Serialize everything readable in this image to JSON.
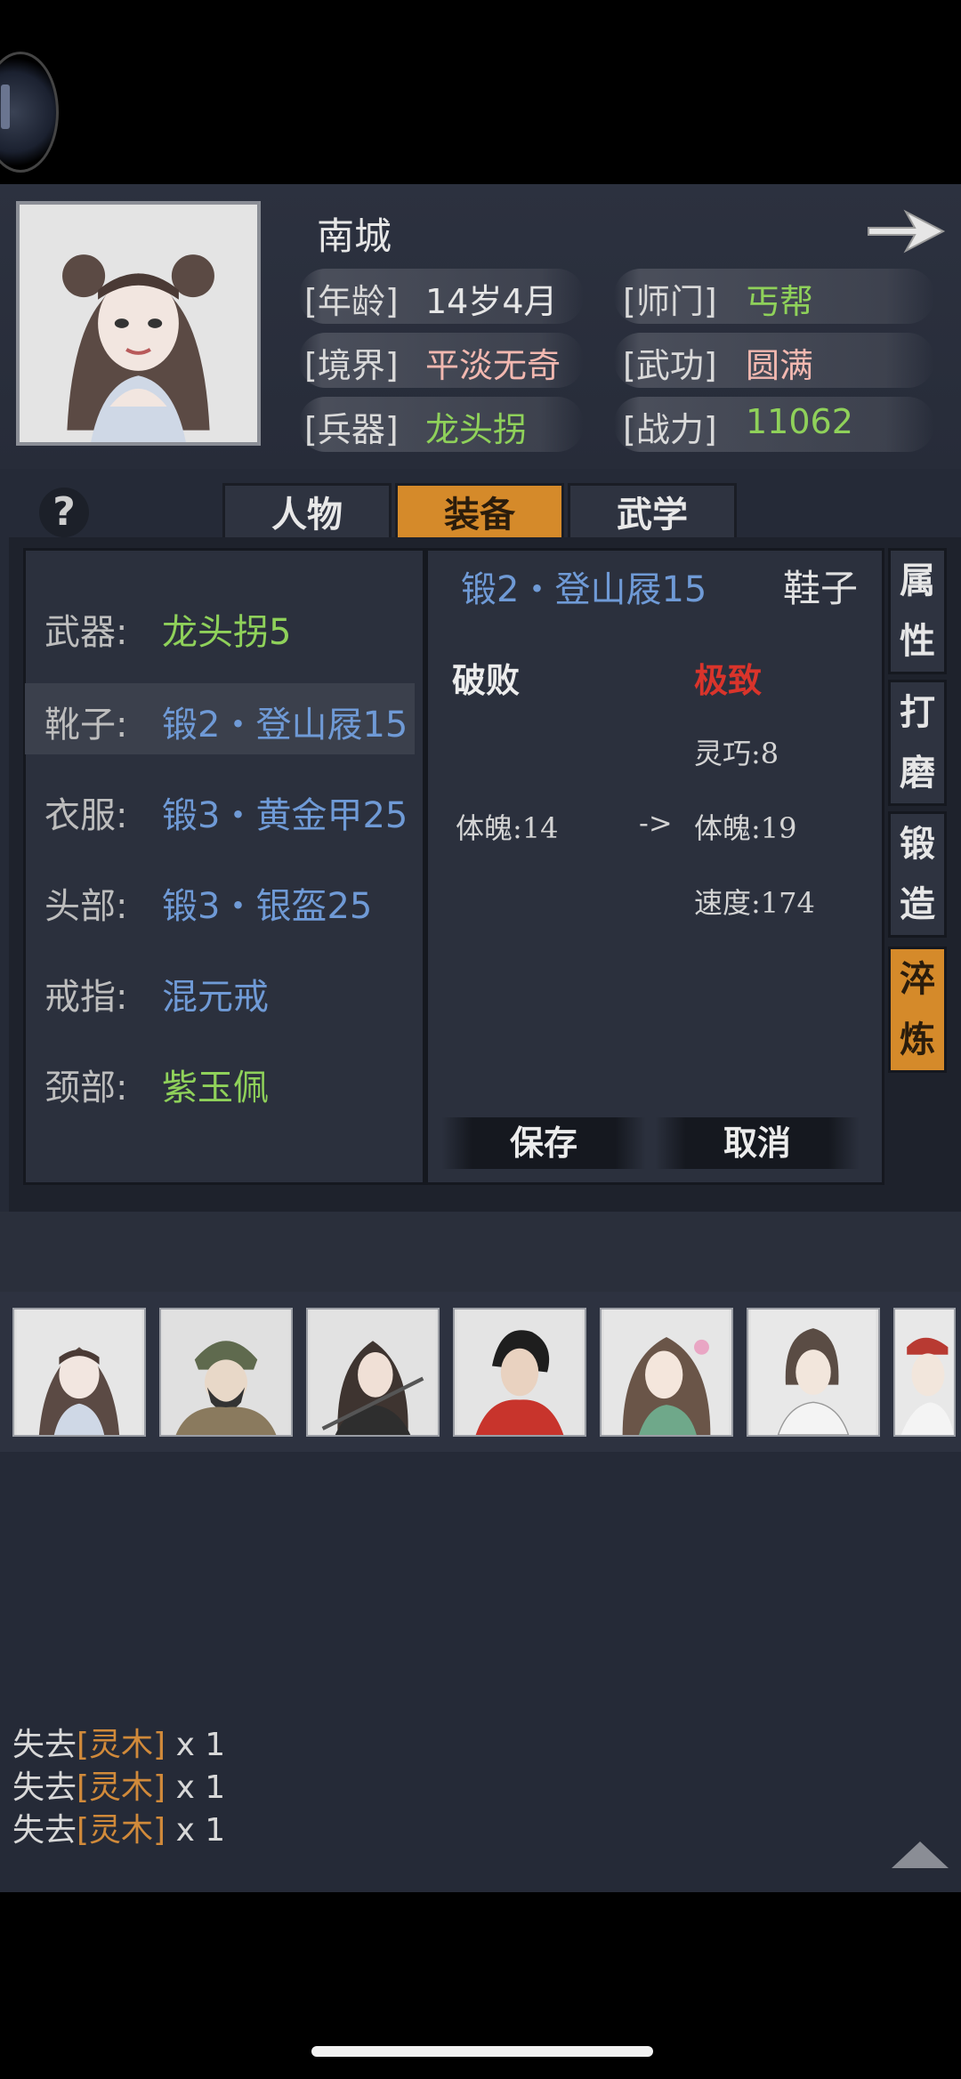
{
  "header": {
    "name": "南城",
    "age_label": "[年龄]",
    "age": "14岁4月",
    "sect_label": "[师门]",
    "sect": "丐帮",
    "realm_label": "[境界]",
    "realm": "平淡无奇",
    "martial_label": "[武功]",
    "martial": "圆满",
    "weapon_label": "[兵器]",
    "weapon": "龙头拐",
    "power_label": "[战力]",
    "power": "11062"
  },
  "tabs": [
    "人物",
    "装备",
    "武学"
  ],
  "active_tab": "装备",
  "help": "?",
  "slots": [
    {
      "label": "武器:",
      "value": "龙头拐5",
      "color": "#8fd15a"
    },
    {
      "label": "靴子:",
      "value": "锻2・登山屐15",
      "color": "#6f9ad6"
    },
    {
      "label": "衣服:",
      "value": "锻3・黄金甲25",
      "color": "#6f9ad6"
    },
    {
      "label": "头部:",
      "value": "锻3・银盔25",
      "color": "#6f9ad6"
    },
    {
      "label": "戒指:",
      "value": "混元戒",
      "color": "#6f9ad6"
    },
    {
      "label": "颈部:",
      "value": "紫玉佩",
      "color": "#8fd15a"
    }
  ],
  "item": {
    "name": "锻2・登山屐15",
    "type": "鞋子",
    "before_grade": "破败",
    "after_grade": "极致",
    "after_grade_color": "#d9342b",
    "stats": {
      "agility_after": "灵巧:8",
      "physique_before": "体魄:14",
      "arrow": "->",
      "physique_after": "体魄:19",
      "speed_after": "速度:174"
    },
    "save": "保存",
    "cancel": "取消"
  },
  "side_tabs": [
    {
      "l1": "属",
      "l2": "性"
    },
    {
      "l1": "打",
      "l2": "磨"
    },
    {
      "l1": "锻",
      "l2": "造"
    },
    {
      "l1": "淬",
      "l2": "炼"
    }
  ],
  "log": [
    {
      "prefix": "失去",
      "item": "[灵木]",
      "qty": "x 1"
    },
    {
      "prefix": "失去",
      "item": "[灵木]",
      "qty": "x 1"
    },
    {
      "prefix": "失去",
      "item": "[灵木]",
      "qty": "x 1"
    }
  ]
}
